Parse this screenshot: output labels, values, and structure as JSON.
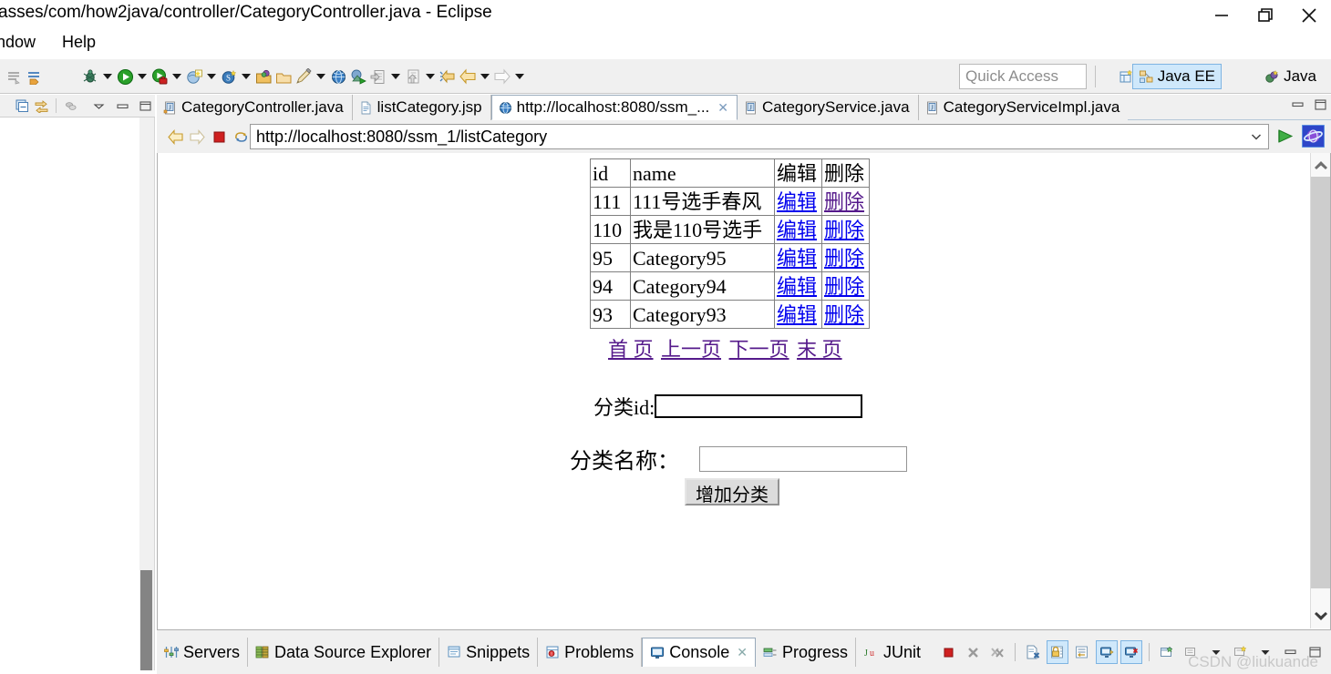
{
  "window": {
    "title": "asses/com/how2java/controller/CategoryController.java - Eclipse",
    "minimize_label": "Minimize",
    "restore_label": "Restore",
    "close_label": "Close"
  },
  "menubar": {
    "items": [
      {
        "label": "ndow"
      },
      {
        "label": "Help"
      }
    ]
  },
  "toolbar": {
    "quick_access_placeholder": "Quick Access",
    "open_perspective_icon": "open-perspective-icon",
    "perspectives": [
      {
        "label": "Java EE",
        "icon": "java-ee-perspective-icon",
        "active": true
      },
      {
        "label": "Java",
        "icon": "java-perspective-icon",
        "active": false
      }
    ],
    "icons": [
      "skip-all-breakpoints-icon",
      "toggle-breakpoint-icon",
      "debug-icon",
      "run-icon",
      "run-server-icon",
      "new-wizard-icon",
      "new-spring-icon",
      "open-type-icon",
      "open-resource-icon",
      "quick-fix-icon",
      "open-web-browser-icon",
      "run-on-server-icon",
      "export-icon",
      "import-icon",
      "back-history-icon",
      "back-icon",
      "forward-icon"
    ]
  },
  "left_view": {
    "toolbar_icons": [
      "collapse-all-icon",
      "link-with-editor-icon",
      "filters-icon",
      "view-menu-icon",
      "minimize-icon",
      "maximize-icon"
    ]
  },
  "editor": {
    "tabs": [
      {
        "label": "CategoryController.java",
        "icon": "java-file-icon",
        "active": false,
        "closable": false
      },
      {
        "label": "listCategory.jsp",
        "icon": "jsp-file-icon",
        "active": false,
        "closable": false
      },
      {
        "label": "http://localhost:8080/ssm_...",
        "icon": "web-browser-icon",
        "active": true,
        "closable": true
      },
      {
        "label": "CategoryService.java",
        "icon": "java-file-icon",
        "active": false,
        "closable": false
      },
      {
        "label": "CategoryServiceImpl.java",
        "icon": "java-file-icon",
        "active": false,
        "closable": false
      }
    ],
    "tabbar_buttons": [
      "minimize-icon",
      "maximize-icon"
    ]
  },
  "browser": {
    "back_icon": "back-arrow-icon",
    "forward_icon": "forward-arrow-icon",
    "stop_icon": "stop-icon",
    "refresh_icon": "refresh-icon",
    "url": "http://localhost:8080/ssm_1/listCategory",
    "url_dropdown_icon": "chevron-down-icon",
    "run_icon": "run-green-arrow-icon",
    "ie_icon": "internet-explorer-icon",
    "scroll_up_icon": "scroll-up-arrow-icon",
    "scroll_down_icon": "scroll-down-arrow-icon"
  },
  "page": {
    "table": {
      "headers": [
        "id",
        "name",
        "编辑",
        "删除"
      ],
      "rows": [
        {
          "id": "111",
          "name": "111号选手春风",
          "edit": "编辑",
          "delete": "删除",
          "edit_visited": false,
          "delete_visited": true
        },
        {
          "id": "110",
          "name": "我是110号选手",
          "edit": "编辑",
          "delete": "删除",
          "edit_visited": false,
          "delete_visited": false
        },
        {
          "id": "95",
          "name": "Category95",
          "edit": "编辑",
          "delete": "删除",
          "edit_visited": false,
          "delete_visited": false
        },
        {
          "id": "94",
          "name": "Category94",
          "edit": "编辑",
          "delete": "删除",
          "edit_visited": false,
          "delete_visited": false
        },
        {
          "id": "93",
          "name": "Category93",
          "edit": "编辑",
          "delete": "删除",
          "edit_visited": false,
          "delete_visited": false
        }
      ]
    },
    "pagination": [
      {
        "label": "首 页"
      },
      {
        "label": "上一页"
      },
      {
        "label": "下一页"
      },
      {
        "label": "末 页"
      }
    ],
    "form": {
      "id_label": "分类id:",
      "id_value": "",
      "name_label": "分类名称：",
      "name_value": "",
      "submit_label": "增加分类"
    }
  },
  "bottom_panel": {
    "tabs": [
      {
        "label": "Servers",
        "icon": "servers-icon",
        "active": false,
        "closable": false
      },
      {
        "label": "Data Source Explorer",
        "icon": "data-source-explorer-icon",
        "active": false,
        "closable": false
      },
      {
        "label": "Snippets",
        "icon": "snippets-icon",
        "active": false,
        "closable": false
      },
      {
        "label": "Problems",
        "icon": "problems-icon",
        "active": false,
        "closable": false
      },
      {
        "label": "Console",
        "icon": "console-icon",
        "active": true,
        "closable": true
      },
      {
        "label": "Progress",
        "icon": "progress-icon",
        "active": false,
        "closable": false
      },
      {
        "label": "JUnit",
        "icon": "junit-icon",
        "active": false,
        "closable": false
      }
    ],
    "buttons": [
      "terminate-icon",
      "remove-launch-icon",
      "remove-all-terminated-icon",
      "clear-console-icon",
      "scroll-lock-icon",
      "word-wrap-icon",
      "show-console-on-output-icon",
      "show-console-on-error-icon",
      "open-console-icon",
      "display-selected-console-icon",
      "new-console-view-icon",
      "minimize-icon",
      "maximize-icon"
    ]
  },
  "watermark": "CSDN @liukuande",
  "colors": {
    "link": "#0000EE",
    "visited_link": "#551A8B",
    "toolbar_bg": "#f0f0f0",
    "active_perspective": "#cfe8fb"
  }
}
